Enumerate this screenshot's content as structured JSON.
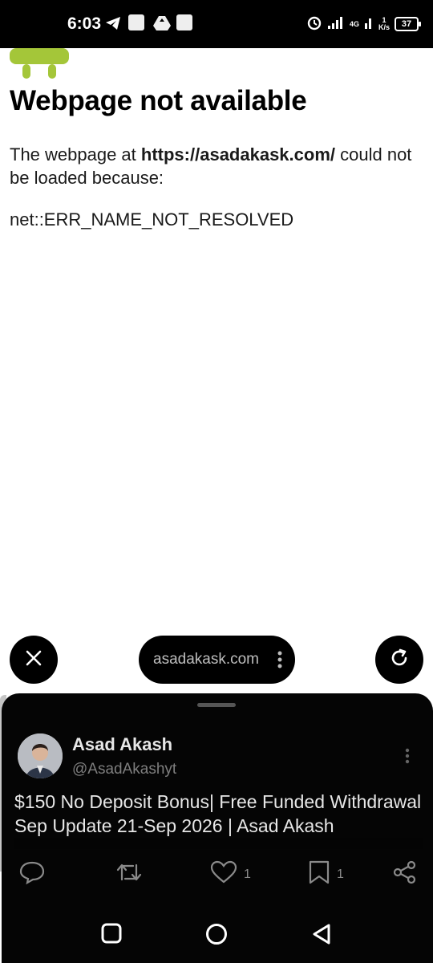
{
  "status_bar": {
    "time": "6:03",
    "network": "4G",
    "speed_value": "1",
    "speed_unit": "K/s",
    "battery": "37"
  },
  "error_page": {
    "title": "Webpage not available",
    "message_prefix": "The webpage at ",
    "url": "https://asadakask.com/",
    "message_suffix": " could not be loaded because:",
    "error_code": "net::ERR_NAME_NOT_RESOLVED"
  },
  "toolbar": {
    "url_display": "asadakask.com"
  },
  "post": {
    "author_name": "Asad Akash",
    "author_handle": "@AsadAkashyt",
    "text": "$150 No Deposit Bonus| Free Funded Withdrawal Sep Update 21-Sep 2026 | Asad Akash",
    "like_count": "1",
    "bookmark_count": "1"
  },
  "colors": {
    "android_green": "#a4c639",
    "sheet_bg": "#050505",
    "status_bar_bg": "#000000"
  }
}
